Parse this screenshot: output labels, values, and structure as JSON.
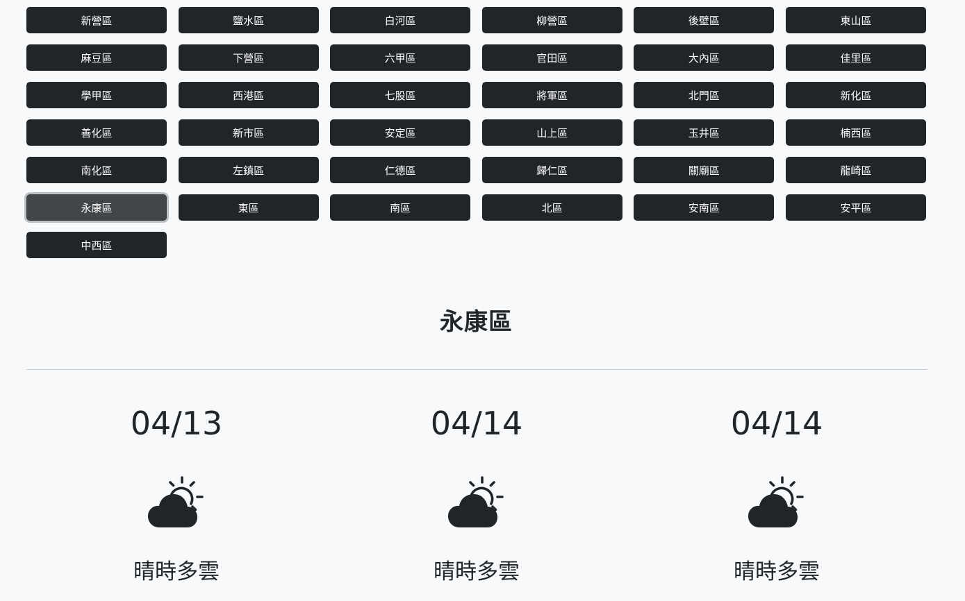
{
  "districts": [
    "新營區",
    "鹽水區",
    "白河區",
    "柳營區",
    "後壁區",
    "東山區",
    "麻豆區",
    "下營區",
    "六甲區",
    "官田區",
    "大內區",
    "佳里區",
    "學甲區",
    "西港區",
    "七股區",
    "將軍區",
    "北門區",
    "新化區",
    "善化區",
    "新市區",
    "安定區",
    "山上區",
    "玉井區",
    "楠西區",
    "南化區",
    "左鎮區",
    "仁德區",
    "歸仁區",
    "關廟區",
    "龍崎區",
    "永康區",
    "東區",
    "南區",
    "北區",
    "安南區",
    "安平區",
    "中西區"
  ],
  "selected_district": "永康區",
  "section_title": "永康區",
  "forecast": [
    {
      "date": "04/13",
      "icon": "partly-cloudy-day-icon",
      "description": "晴時多雲"
    },
    {
      "date": "04/14",
      "icon": "partly-cloudy-day-icon",
      "description": "晴時多雲"
    },
    {
      "date": "04/14",
      "icon": "partly-cloudy-day-icon",
      "description": "晴時多雲"
    }
  ],
  "colors": {
    "button_bg": "#212529",
    "button_active_bg": "#424649",
    "page_bg": "#f8f9fa",
    "text": "#212529"
  }
}
